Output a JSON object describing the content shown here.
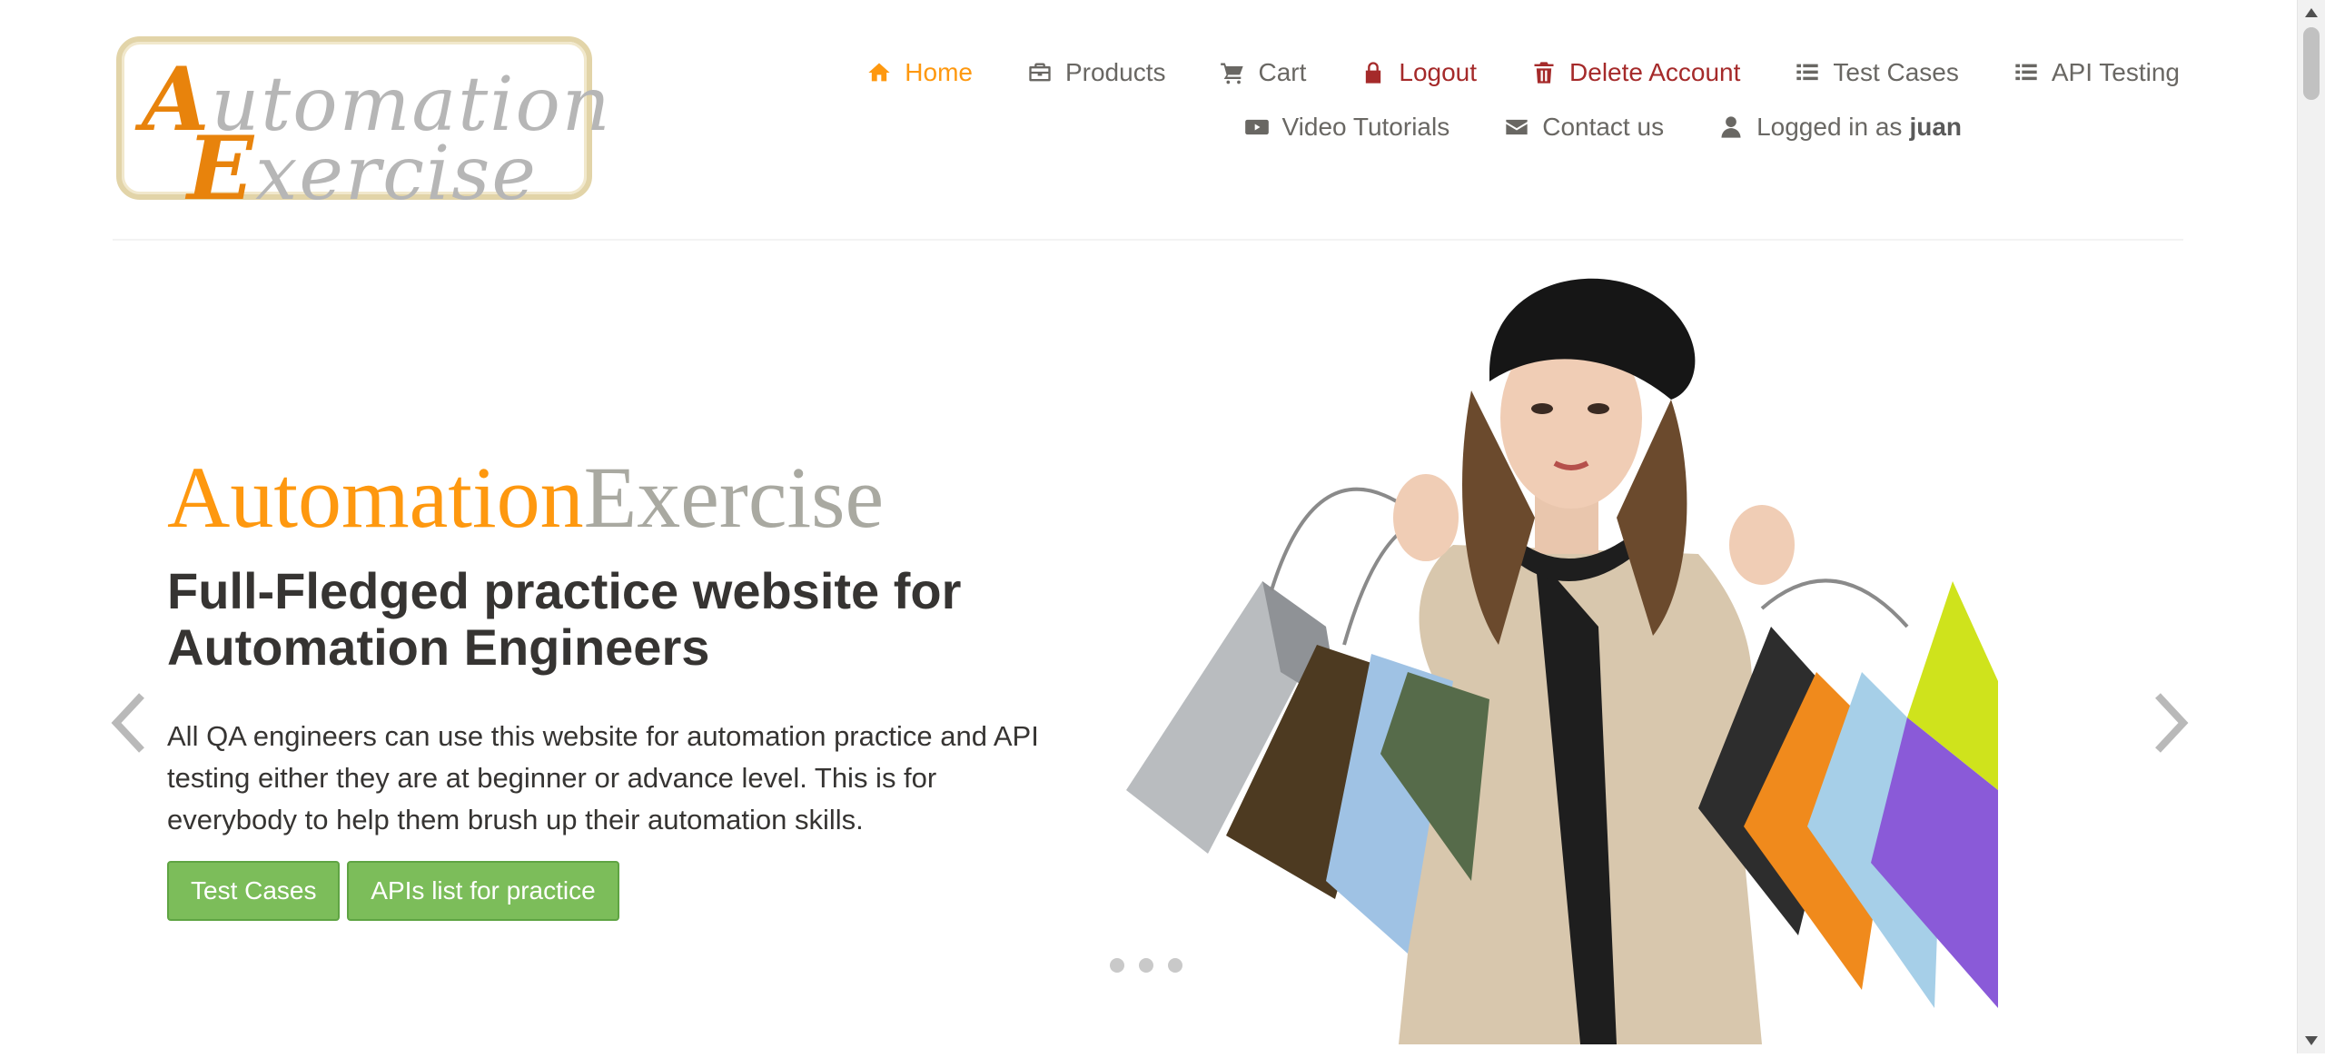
{
  "logo": {
    "line1_cap": "A",
    "line1_rest": "utomation",
    "line2_cap": "E",
    "line2_rest": "xercise"
  },
  "nav": {
    "row1": [
      {
        "label": "Home",
        "icon": "home-icon"
      },
      {
        "label": "Products",
        "icon": "briefcase-icon"
      },
      {
        "label": "Cart",
        "icon": "cart-icon"
      },
      {
        "label": "Logout",
        "icon": "lock-icon"
      },
      {
        "label": "Delete Account",
        "icon": "trash-icon"
      },
      {
        "label": "Test Cases",
        "icon": "list-icon"
      },
      {
        "label": "API Testing",
        "icon": "list-icon"
      }
    ],
    "row2": [
      {
        "label": "Video Tutorials",
        "icon": "youtube-icon"
      },
      {
        "label": "Contact us",
        "icon": "envelope-icon"
      },
      {
        "label": "Logged in as",
        "icon": "user-icon",
        "username": "juan"
      }
    ]
  },
  "hero": {
    "brand_part1": "Automation",
    "brand_part2": "Exercise",
    "headline": "Full-Fledged practice website for Automation Engineers",
    "description": "All QA engineers can use this website for automation practice and API testing either they are at beginner or advance level. This is for everybody to help them brush up their automation skills.",
    "button_test_cases": "Test Cases",
    "button_apis": "APIs list for practice",
    "slide_count": 3
  },
  "colors": {
    "accent": "#fe980f",
    "danger": "#a52a2a",
    "text": "#696763",
    "heading": "#363432",
    "button": "#7cbd5a"
  }
}
